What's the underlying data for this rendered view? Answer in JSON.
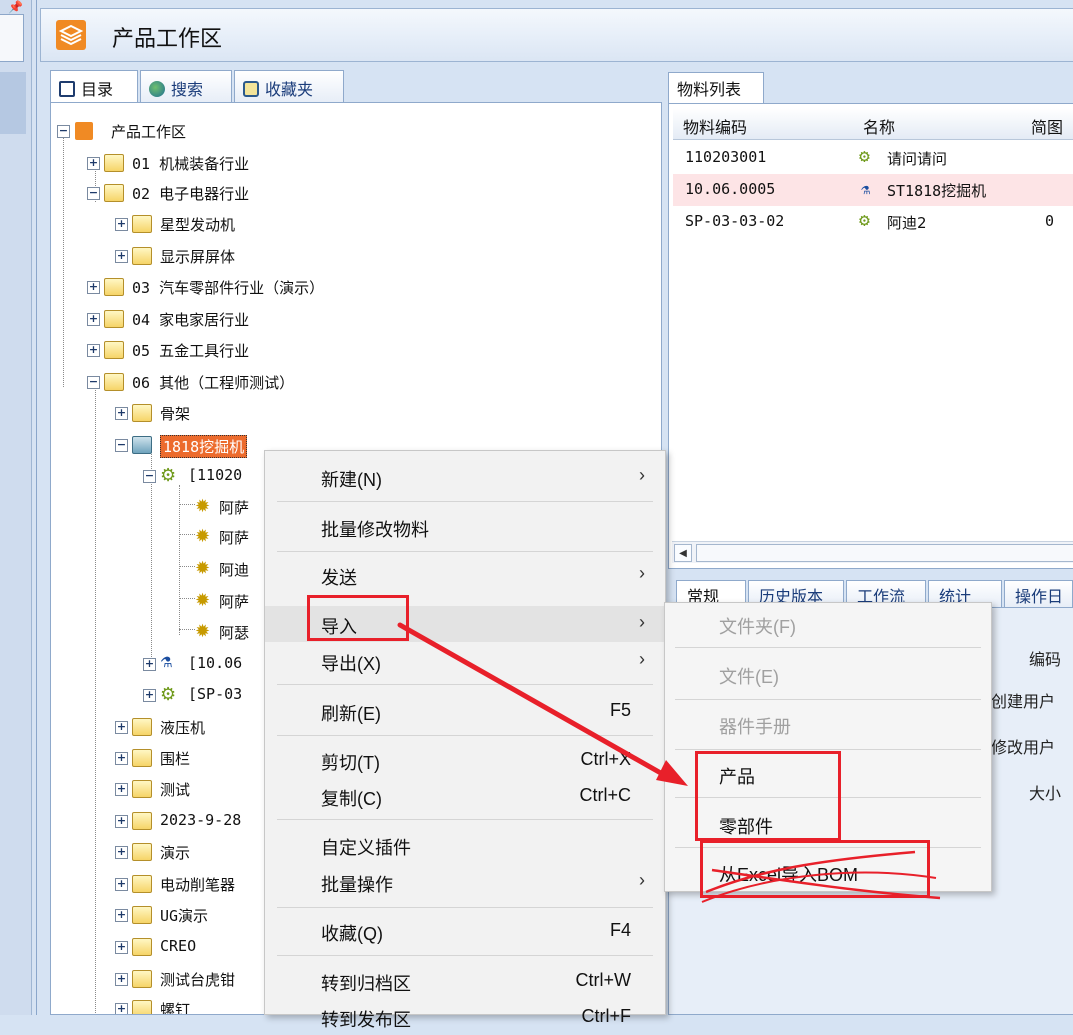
{
  "header": {
    "title": "产品工作区",
    "pin_glyph": "📌"
  },
  "left_tabs": [
    {
      "label": "目录",
      "icon": "directory-icon"
    },
    {
      "label": "搜索",
      "icon": "search-icon"
    },
    {
      "label": "收藏夹",
      "icon": "favorites-icon"
    }
  ],
  "tree": {
    "root": "产品工作区",
    "items": [
      {
        "label": "01 机械装备行业",
        "exp": "+"
      },
      {
        "label": "02 电子电器行业",
        "exp": "−"
      },
      {
        "label": "星型发动机",
        "exp": "+"
      },
      {
        "label": "显示屏屏体",
        "exp": "+"
      },
      {
        "label": "03 汽车零部件行业（演示）",
        "exp": "+"
      },
      {
        "label": "04 家电家居行业",
        "exp": "+"
      },
      {
        "label": "05 五金工具行业",
        "exp": "+"
      },
      {
        "label": "06 其他（工程师测试）",
        "exp": "−"
      },
      {
        "label": "骨架",
        "exp": "+"
      },
      {
        "label": "1818挖掘机",
        "exp": "−"
      },
      {
        "label": "[11020",
        "exp": "−"
      },
      {
        "label": "阿萨"
      },
      {
        "label": "阿萨"
      },
      {
        "label": "阿迪"
      },
      {
        "label": "阿萨"
      },
      {
        "label": "阿瑟"
      },
      {
        "label": "[10.06",
        "exp": "+"
      },
      {
        "label": "[SP-03",
        "exp": "+"
      },
      {
        "label": "液压机",
        "exp": "+"
      },
      {
        "label": "围栏",
        "exp": "+"
      },
      {
        "label": "测试",
        "exp": "+"
      },
      {
        "label": "2023-9-28",
        "exp": "+"
      },
      {
        "label": "演示",
        "exp": "+"
      },
      {
        "label": "电动削笔器",
        "exp": "+"
      },
      {
        "label": "UG演示",
        "exp": "+"
      },
      {
        "label": "CREO",
        "exp": "+"
      },
      {
        "label": "测试台虎钳",
        "exp": "+"
      },
      {
        "label": "螺钉",
        "exp": "+"
      }
    ]
  },
  "material_list": {
    "tab": "物料列表",
    "columns": [
      "物料编码",
      "名称",
      "简图"
    ],
    "rows": [
      {
        "code": "110203001",
        "name": "请问请问",
        "thumb": ""
      },
      {
        "code": "10.06.0005",
        "name": "ST1818挖掘机",
        "thumb": ""
      },
      {
        "code": "SP-03-03-02",
        "name": "阿迪2",
        "thumb": "0"
      }
    ]
  },
  "detail_tabs": [
    "常规",
    "历史版本",
    "工作流",
    "统计",
    "操作日"
  ],
  "properties": [
    "编码",
    "创建用户",
    "修改用户",
    "大小"
  ],
  "context_menu": [
    {
      "label": "新建(N)",
      "shortcut": "",
      "arrow": "›"
    },
    {
      "label": "批量修改物料",
      "shortcut": "",
      "arrow": ""
    },
    {
      "label": "发送",
      "shortcut": "",
      "arrow": "›"
    },
    {
      "label": "导入",
      "shortcut": "",
      "arrow": "›"
    },
    {
      "label": "导出(X)",
      "shortcut": "",
      "arrow": "›"
    },
    {
      "label": "刷新(E)",
      "shortcut": "F5",
      "arrow": ""
    },
    {
      "label": "剪切(T)",
      "shortcut": "Ctrl+X",
      "arrow": ""
    },
    {
      "label": "复制(C)",
      "shortcut": "Ctrl+C",
      "arrow": ""
    },
    {
      "label": "自定义插件",
      "shortcut": "",
      "arrow": ""
    },
    {
      "label": "批量操作",
      "shortcut": "",
      "arrow": "›"
    },
    {
      "label": "收藏(Q)",
      "shortcut": "F4",
      "arrow": ""
    },
    {
      "label": "转到归档区",
      "shortcut": "Ctrl+W",
      "arrow": ""
    },
    {
      "label": "转到发布区",
      "shortcut": "Ctrl+F",
      "arrow": ""
    }
  ],
  "submenu": [
    {
      "label": "文件夹(F)",
      "disabled": true
    },
    {
      "label": "文件(E)",
      "disabled": true
    },
    {
      "label": "器件手册",
      "disabled": true
    },
    {
      "label": "产品",
      "disabled": false
    },
    {
      "label": "零部件",
      "disabled": false
    },
    {
      "label": "从Excel导入BOM",
      "disabled": false
    }
  ],
  "colors": {
    "accent_orange": "#ec6b2d",
    "annotation_red": "#e8202a",
    "selected_row": "#fde4e6"
  }
}
